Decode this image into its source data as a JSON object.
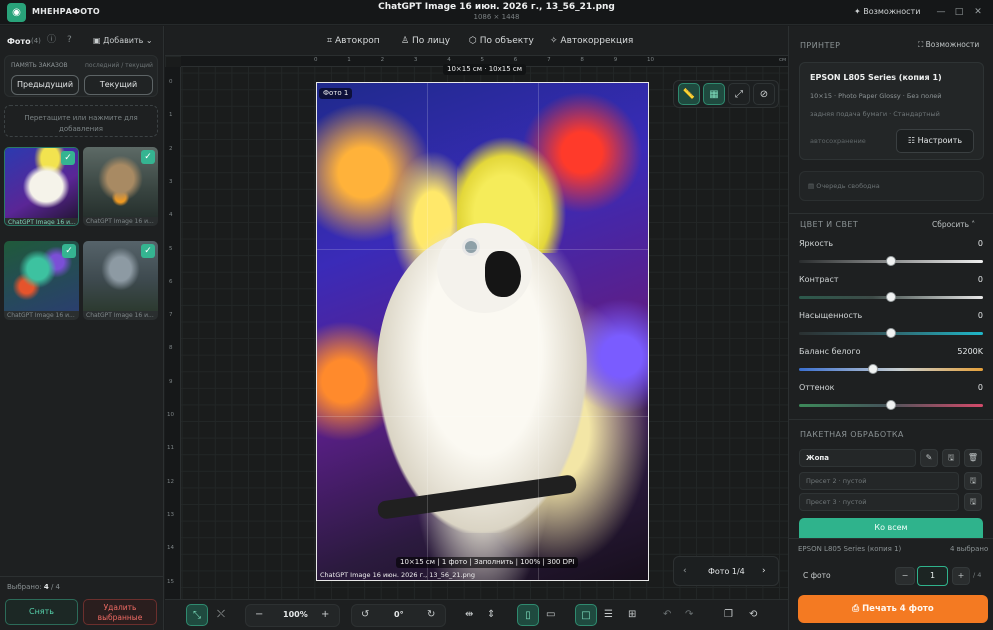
{
  "app": {
    "name": "МНЕНРАФОТО",
    "window_title": "ChatGPT Image 16 июн. 2026 г., 13_56_21.png",
    "window_subtitle": "1086 × 1448",
    "capabilities": "Возможности"
  },
  "left": {
    "photos_label": "Фото",
    "photos_count": "(4)",
    "add_label": "Добавить",
    "memory_title": "ПАМЯТЬ ЗАКАЗОВ",
    "memory_hint": "последний / текущий",
    "prev_btn": "Предыдущий",
    "current_btn": "Текущий",
    "drop_text": "Перетащите или нажмите для добавления",
    "thumbs": [
      {
        "caption": "ChatGPT Image 16 и...",
        "checked": true
      },
      {
        "caption": "ChatGPT Image 16 и...",
        "checked": true
      },
      {
        "caption": "ChatGPT Image 16 и...",
        "checked": true
      },
      {
        "caption": "ChatGPT Image 16 и...",
        "checked": true
      }
    ],
    "selected_label": "Выбрано:",
    "selected_count": "4",
    "selected_total": "/ 4",
    "deselect_btn": "Снять",
    "delete_btn_line1": "Удалить",
    "delete_btn_line2": "выбранные"
  },
  "toolbar": {
    "autocrop": "Автокроп",
    "by_face": "По лицу",
    "by_object": "По объекту",
    "autocorrect": "Автокоррекция"
  },
  "canvas": {
    "ruler_unit": "см",
    "size_badge": "10×15 см · 10x15 см",
    "photo_badge": "Фото 1",
    "info_bar": "10×15 см | 1 фото | Заполнить | 100% | 300 DPI",
    "filename": "ChatGPT Image 16 июн. 2026 г., 13_56_21.png",
    "pager": "Фото 1/4",
    "ruler_x": [
      "0",
      "1",
      "2",
      "3",
      "4",
      "5",
      "6",
      "7",
      "8",
      "9",
      "10"
    ],
    "ruler_y": [
      "0",
      "1",
      "2",
      "3",
      "4",
      "5",
      "6",
      "7",
      "8",
      "9",
      "10",
      "11",
      "12",
      "13",
      "14",
      "15"
    ]
  },
  "bottom": {
    "zoom": "100%",
    "rotation": "0°"
  },
  "right": {
    "printer_section": "ПРИНТЕР",
    "capabilities": "Возможности",
    "printer_name": "EPSON L805 Series (копия 1)",
    "printer_spec": "10×15 · Photo Paper Glossy · Без полей",
    "printer_feed": "задняя подача бумаги · Стандартный",
    "autosave": "автосохранение",
    "configure_btn": "Настроить",
    "queue": "Очередь свободна",
    "color_section": "ЦВЕТ И СВЕТ",
    "reset": "Сбросить",
    "sliders": [
      {
        "label": "Яркость",
        "value": "0",
        "level": 0.5
      },
      {
        "label": "Контраст",
        "value": "0",
        "level": 0.5
      },
      {
        "label": "Насыщенность",
        "value": "0",
        "level": 0.5
      },
      {
        "label": "Баланс белого",
        "value": "5200K",
        "level": 0.4
      },
      {
        "label": "Оттенок",
        "value": "0",
        "level": 0.5
      }
    ],
    "batch_section": "ПАКЕТНАЯ ОБРАБОТКА",
    "preset1": "Жопа",
    "preset2": "Пресет 2 · пустой",
    "preset3": "Пресет 3 · пустой",
    "apply_all": "Ко всем",
    "footer_printer": "EPSON L805 Series (копия 1)",
    "footer_selected": "4 выбрано",
    "copies_label": "С фото",
    "copies_value": "1",
    "copies_total": "/ 4",
    "print_btn": "Печать 4 фото"
  },
  "colors": {
    "accent": "#2fb38c",
    "print": "#f47a22",
    "delete": "#e0554f"
  }
}
